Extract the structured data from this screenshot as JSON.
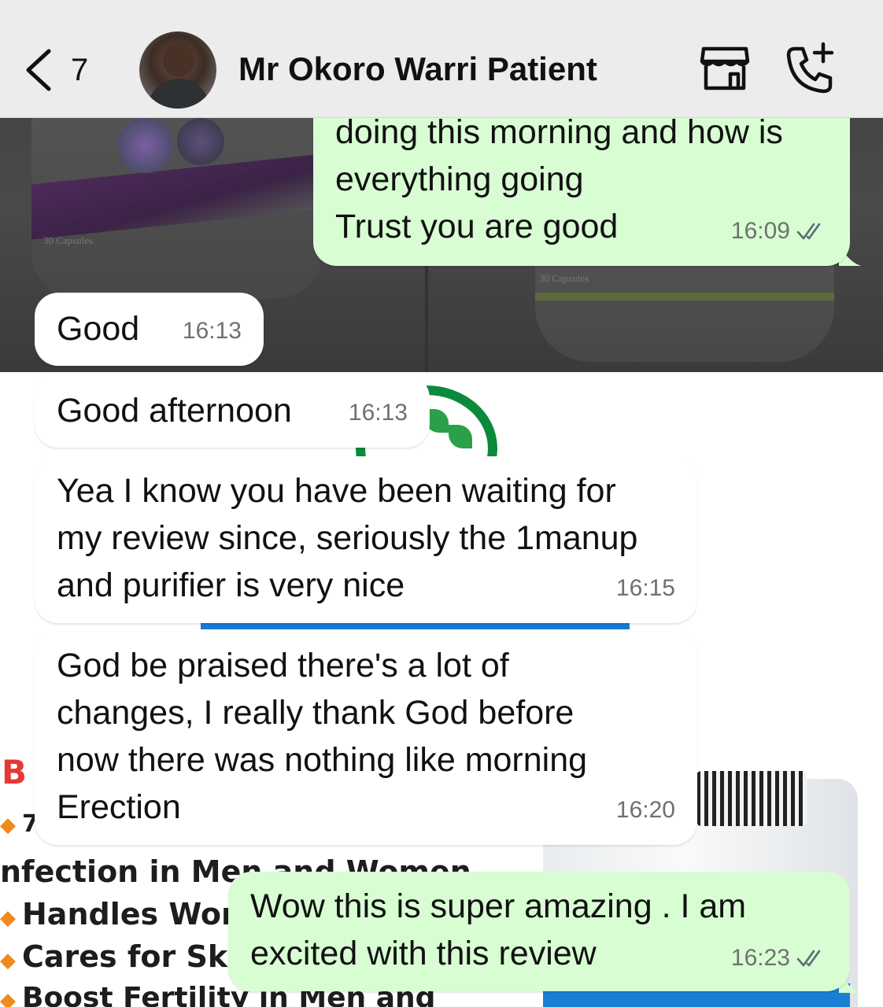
{
  "header": {
    "back_count": "7",
    "contact_name": "Mr Okoro Warri Patient",
    "icons": {
      "back": "chevron-left-icon",
      "store": "storefront-icon",
      "call": "add-call-icon",
      "read": "double-check-icon"
    }
  },
  "colors": {
    "outgoing_bubble": "#d8fdd3",
    "incoming_bubble": "#ffffff",
    "header_bg": "#ececec",
    "timestamp": "#707070"
  },
  "messages": [
    {
      "direction": "out",
      "text": "doing this morning and how is\neverything going\nTrust you are good",
      "time": "16:09",
      "status": "read"
    },
    {
      "direction": "in",
      "text": "Good",
      "time": "16:13"
    },
    {
      "direction": "in",
      "text": "Good afternoon",
      "time": "16:13"
    },
    {
      "direction": "in",
      "text": "Yea I know you have been waiting for\nmy review since, seriously the 1manup\nand purifier is very nice",
      "time": "16:15"
    },
    {
      "direction": "in",
      "text": "God be praised there's a lot of\nchanges, I really thank God before\nnow there was nothing like morning\nErection",
      "time": "16:20"
    },
    {
      "direction": "out",
      "text": "Wow this is super amazing . I am\nexcited with this review",
      "time": "16:23",
      "status": "read"
    }
  ],
  "wallpaper": {
    "caps_label_left": "30 Capsules",
    "caps_label_right": "30 Capsules",
    "red_heading": "B",
    "lines": [
      "7",
      "nfection in Men and Women",
      "Handles Won",
      "Cares for Skin",
      "Boost Fertility in Men and"
    ]
  }
}
